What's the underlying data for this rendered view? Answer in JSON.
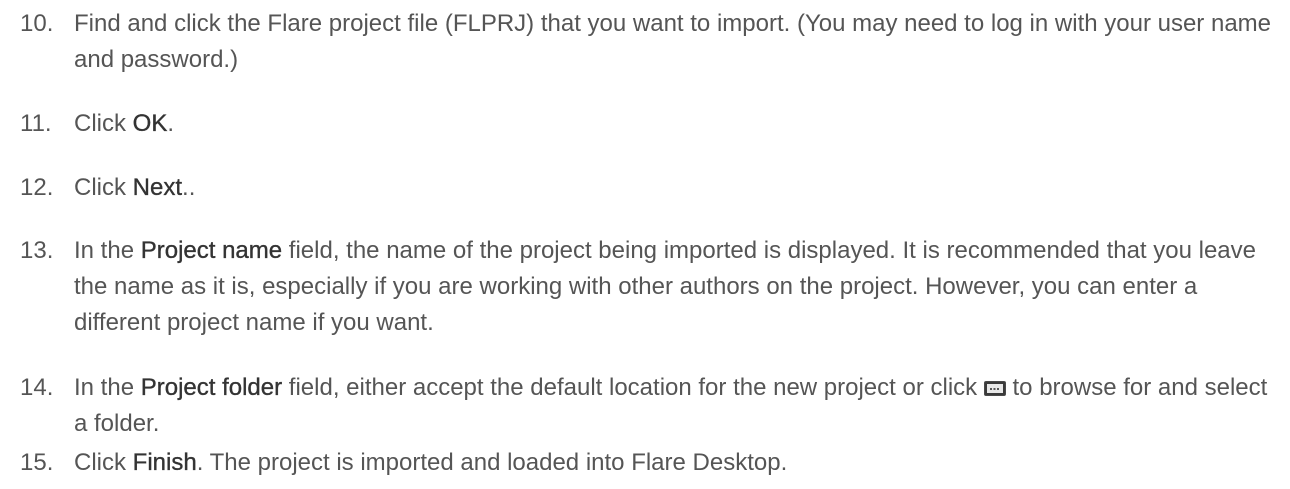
{
  "steps": [
    {
      "number": "10.",
      "text": "Find and click the Flare project file (FLPRJ) that you want to import. (You may need to log in with your user name and password.)"
    },
    {
      "number": "11.",
      "prefix": "Click ",
      "ui": "OK",
      "suffix": "."
    },
    {
      "number": "12.",
      "prefix": "Click ",
      "ui": "Next",
      "suffix": ".."
    },
    {
      "number": "13.",
      "prefix": "In the ",
      "ui": "Project name",
      "suffix": " field, the name of the project being imported is displayed. It is recommended that you leave the name as it is, especially if you are working with other authors on the project. However, you can enter a different project name if you want."
    },
    {
      "number": "14.",
      "prefix": "In the ",
      "ui": "Project folder",
      "middle": " field, either accept the default location for the new project or click ",
      "icon": "browse-button-icon",
      "suffix": " to browse for and select a folder."
    },
    {
      "number": "15.",
      "prefix": "Click ",
      "ui": "Finish",
      "suffix": ". The project is imported and loaded into Flare Desktop."
    }
  ]
}
